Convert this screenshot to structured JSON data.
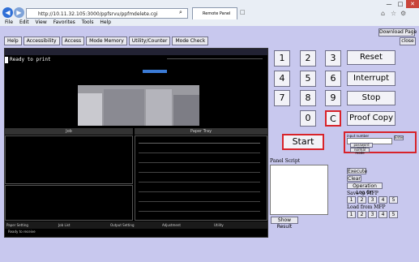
{
  "browser": {
    "address": "http://10.11.32.105:3000/ppfsrvu/ppfmdelete.cgi",
    "tab_title": "Remote Panel",
    "menu": [
      "File",
      "Edit",
      "View",
      "Favorites",
      "Tools",
      "Help"
    ]
  },
  "page": {
    "download_label": "Download Page",
    "close_label": "close",
    "tools": [
      "Help",
      "Accessibility",
      "Access",
      "Mode Memory",
      "Utility/Counter",
      "Mode Check"
    ]
  },
  "screen": {
    "status_text": "Ready to print",
    "panel_left_title": "Job",
    "panel_right_title": "Paper Tray",
    "bottom_tabs": [
      "Paper Setting",
      "Job List",
      "Output Setting",
      "Adjustment",
      "Utility"
    ],
    "footer_text": "Ready to receive"
  },
  "keypad": {
    "keys": [
      "1",
      "2",
      "3",
      "4",
      "5",
      "6",
      "7",
      "8",
      "9",
      "0",
      "C"
    ],
    "reset": "Reset",
    "interrupt": "Interrupt",
    "stop": "Stop",
    "proof": "Proof Copy",
    "start": "Start"
  },
  "input_area": {
    "title": "input number",
    "enter_label": "Enter",
    "password_mode": "password mode",
    "normal_mode": "normal mode"
  },
  "script": {
    "label": "Panel Script",
    "execute": "Execute",
    "clear": "Clear",
    "operation_log_on": "Operation Log On",
    "save_label": "Save to MFP",
    "load_label": "Load from MFP",
    "show_result": "Show Result",
    "save_slots": [
      "1",
      "2",
      "3",
      "4",
      "5"
    ],
    "load_slots": [
      "1",
      "2",
      "3",
      "4",
      "5"
    ]
  }
}
